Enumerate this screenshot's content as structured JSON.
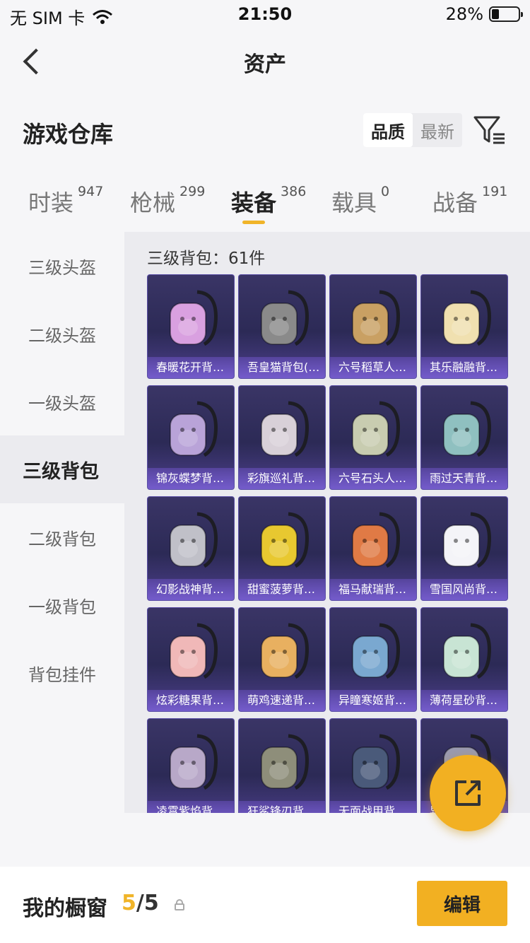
{
  "status_bar": {
    "carrier": "无 SIM 卡",
    "time": "21:50",
    "battery": "28%"
  },
  "nav": {
    "title": "资产"
  },
  "section": {
    "title": "游戏仓库",
    "sort_options": [
      "品质",
      "最新"
    ],
    "active_sort": "品质"
  },
  "tabs": [
    {
      "label": "时装",
      "count": "947"
    },
    {
      "label": "枪械",
      "count": "299"
    },
    {
      "label": "装备",
      "count": "386"
    },
    {
      "label": "载具",
      "count": "0"
    },
    {
      "label": "战备",
      "count": "191"
    }
  ],
  "sidebar": [
    {
      "label": "三级头盔"
    },
    {
      "label": "二级头盔"
    },
    {
      "label": "一级头盔"
    },
    {
      "label": "三级背包"
    },
    {
      "label": "二级背包"
    },
    {
      "label": "一级背包"
    },
    {
      "label": "背包挂件"
    }
  ],
  "panel": {
    "heading": "三级背包：61件",
    "items": [
      {
        "name": "春暖花开背…",
        "color": "#d9a0e0"
      },
      {
        "name": "吾皇猫背包(…",
        "color": "#8a8a8a"
      },
      {
        "name": "六号稻草人…",
        "color": "#c9a063"
      },
      {
        "name": "其乐融融背…",
        "color": "#f0e0b0"
      },
      {
        "name": "锦灰蝶梦背…",
        "color": "#b9a3d8"
      },
      {
        "name": "彩旗巡礼背…",
        "color": "#d8d0d8"
      },
      {
        "name": "六号石头人…",
        "color": "#c8ccb0"
      },
      {
        "name": "雨过天青背…",
        "color": "#8fc0c0"
      },
      {
        "name": "幻影战神背…",
        "color": "#c0c0c8"
      },
      {
        "name": "甜蜜菠萝背…",
        "color": "#e8c830"
      },
      {
        "name": "福马献瑞背…",
        "color": "#e07a45"
      },
      {
        "name": "雪国风尚背…",
        "color": "#f4f4f8"
      },
      {
        "name": "炫彩糖果背…",
        "color": "#f0b8b8"
      },
      {
        "name": "萌鸡速递背…",
        "color": "#e8b060"
      },
      {
        "name": "异瞳寒姬背…",
        "color": "#7aa8d0"
      },
      {
        "name": "薄荷星砂背…",
        "color": "#c8e4d4"
      },
      {
        "name": "凌霄紫焰背…",
        "color": "#b8a8c8"
      },
      {
        "name": "狂鲨锋刃背…",
        "color": "#8e8e7a"
      },
      {
        "name": "无面战甲背…",
        "color": "#4a5a7a"
      },
      {
        "name": "异…",
        "color": "#9a9ab0"
      }
    ]
  },
  "bottom_bar": {
    "label": "我的橱窗",
    "count_current": "5",
    "count_total": "/5",
    "edit_label": "编辑"
  }
}
